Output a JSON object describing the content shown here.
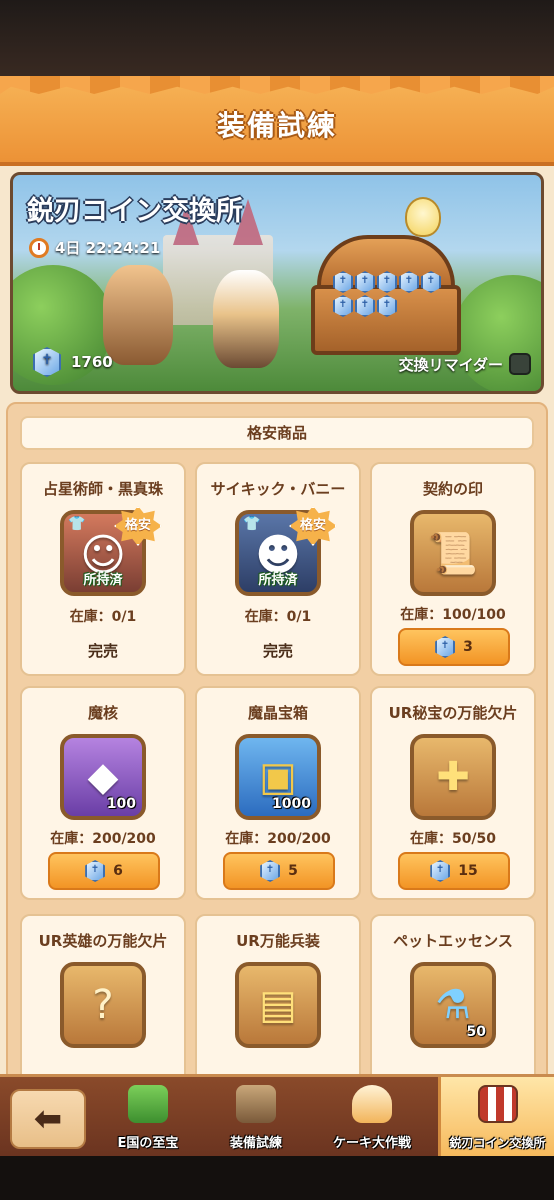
{
  "header": {
    "title": "装備試練"
  },
  "banner": {
    "title": "鋭刃コイン交換所",
    "timer": "4日 22:24:21",
    "coin_count": "1760",
    "reminder_label": "交換リマイダー"
  },
  "shop": {
    "section_title": "格安商品",
    "items": [
      {
        "name": "占星術師・黒真珠",
        "badge": "格安",
        "owned_label": "所持済",
        "stock": "在庫：0/1",
        "status": "完売",
        "icon": "hero-portrait-icon"
      },
      {
        "name": "サイキック・バニー",
        "badge": "格安",
        "owned_label": "所持済",
        "stock": "在庫：0/1",
        "status": "完売",
        "icon": "hero-portrait-icon"
      },
      {
        "name": "契約の印",
        "stock": "在庫：100/100",
        "price": "3",
        "icon": "contract-scroll-icon"
      },
      {
        "name": "魔核",
        "qty": "100",
        "stock": "在庫：200/200",
        "price": "6",
        "icon": "purple-crystal-icon"
      },
      {
        "name": "魔晶宝箱",
        "qty": "1000",
        "stock": "在庫：200/200",
        "price": "5",
        "icon": "treasure-chest-icon"
      },
      {
        "name": "UR秘宝の万能欠片",
        "stock": "在庫：50/50",
        "price": "15",
        "icon": "puzzle-piece-icon"
      },
      {
        "name": "UR英雄の万能欠片",
        "icon": "puzzle-piece-icon"
      },
      {
        "name": "UR万能兵装",
        "icon": "gear-card-icon"
      },
      {
        "name": "ペットエッセンス",
        "qty": "50",
        "icon": "potion-flask-icon"
      }
    ]
  },
  "bottom_nav": {
    "tabs": [
      {
        "label": "E国の至宝",
        "icon": "gift-box-icon"
      },
      {
        "label": "装備試練",
        "icon": "armor-icon"
      },
      {
        "label": "ケーキ大作戦",
        "icon": "cake-icon"
      },
      {
        "label": "鋭刃コイン交換所",
        "icon": "shop-stall-icon"
      }
    ]
  },
  "colors": {
    "header": "#ec9236",
    "button": "#f29425",
    "card_bg": "#fff5e6",
    "text_brown": "#6b3e1f"
  }
}
